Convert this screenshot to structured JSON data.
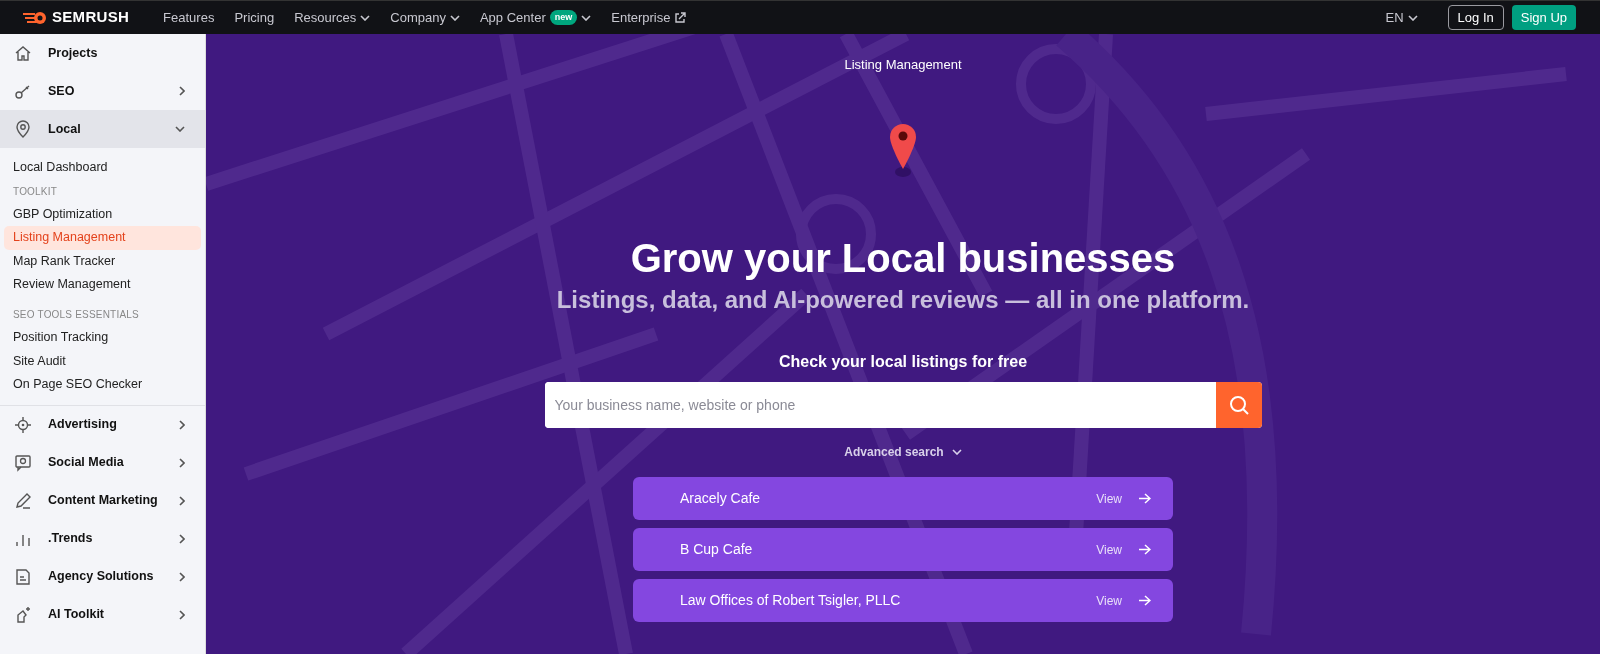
{
  "topbar": {
    "logo": "SEMRUSH",
    "nav": [
      {
        "label": "Features",
        "dropdown": false,
        "external": false
      },
      {
        "label": "Pricing",
        "dropdown": false,
        "external": false
      },
      {
        "label": "Resources",
        "dropdown": true,
        "external": false
      },
      {
        "label": "Company",
        "dropdown": true,
        "external": false
      },
      {
        "label": "App Center",
        "badge": "new",
        "dropdown": true,
        "external": false
      },
      {
        "label": "Enterprise",
        "dropdown": false,
        "external": true
      }
    ],
    "language": "EN",
    "login": "Log In",
    "signup": "Sign Up"
  },
  "sidebar": {
    "sections": [
      {
        "label": "Projects",
        "expandable": false,
        "expanded": false
      },
      {
        "label": "SEO",
        "expandable": true,
        "expanded": false
      },
      {
        "label": "Local",
        "expandable": true,
        "expanded": true,
        "children": [
          {
            "kind": "link",
            "label": "Local Dashboard",
            "selected": false
          },
          {
            "kind": "heading",
            "label": "TOOLKIT"
          },
          {
            "kind": "link",
            "label": "GBP Optimization",
            "selected": false
          },
          {
            "kind": "link",
            "label": "Listing Management",
            "selected": true
          },
          {
            "kind": "link",
            "label": "Map Rank Tracker",
            "selected": false
          },
          {
            "kind": "link",
            "label": "Review Management",
            "selected": false
          },
          {
            "kind": "heading",
            "label": "SEO TOOLS ESSENTIALS"
          },
          {
            "kind": "link",
            "label": "Position Tracking",
            "selected": false
          },
          {
            "kind": "link",
            "label": "Site Audit",
            "selected": false
          },
          {
            "kind": "link",
            "label": "On Page SEO Checker",
            "selected": false
          }
        ]
      },
      {
        "label": "Advertising",
        "expandable": true,
        "expanded": false
      },
      {
        "label": "Social Media",
        "expandable": true,
        "expanded": false
      },
      {
        "label": "Content Marketing",
        "expandable": true,
        "expanded": false
      },
      {
        "label": ".Trends",
        "expandable": true,
        "expanded": false
      },
      {
        "label": "Agency Solutions",
        "expandable": true,
        "expanded": false
      },
      {
        "label": "AI Toolkit",
        "expandable": true,
        "expanded": false
      }
    ]
  },
  "hero": {
    "eyebrow": "Listing Management",
    "title": "Grow your Local businesses",
    "subtitle": "Listings, data, and AI-powered reviews — all in one platform.",
    "search_label": "Check your local listings for free",
    "search": {
      "placeholder": "Your business name, website or phone"
    },
    "advanced_search": "Advanced search",
    "results": [
      {
        "name": "Aracely Cafe",
        "action": "View"
      },
      {
        "name": "B Cup Cafe",
        "action": "View"
      },
      {
        "name": "Law Offices of Robert Tsigler, PLLC",
        "action": "View"
      }
    ]
  }
}
